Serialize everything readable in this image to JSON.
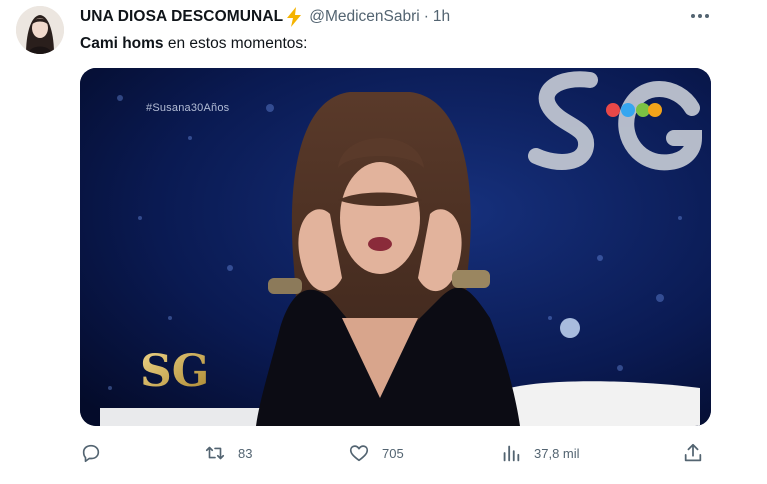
{
  "author": {
    "display_name": "UNA DIOSA DESCOMUNAL",
    "handle": "@MedicenSabri",
    "separator": "·",
    "time": "1h"
  },
  "tweet": {
    "mention": "Cami homs",
    "text": " en estos momentos:"
  },
  "media": {
    "hashtag": "#Susana30Años",
    "logo_text": "SG",
    "colors": {
      "background": "#06113a",
      "logo_gold": "#c9a94a",
      "logo_silver": "#c8cdd6"
    }
  },
  "actions": {
    "reply": {
      "icon": "reply-icon"
    },
    "retweet": {
      "icon": "retweet-icon",
      "count": "83"
    },
    "like": {
      "icon": "heart-icon",
      "count": "705"
    },
    "views": {
      "icon": "views-chart-icon",
      "count": "37,8 mil"
    },
    "share": {
      "icon": "share-icon"
    }
  },
  "colors": {
    "text": "#0f1419",
    "secondary": "#536471",
    "bolt": "#f5b300"
  }
}
